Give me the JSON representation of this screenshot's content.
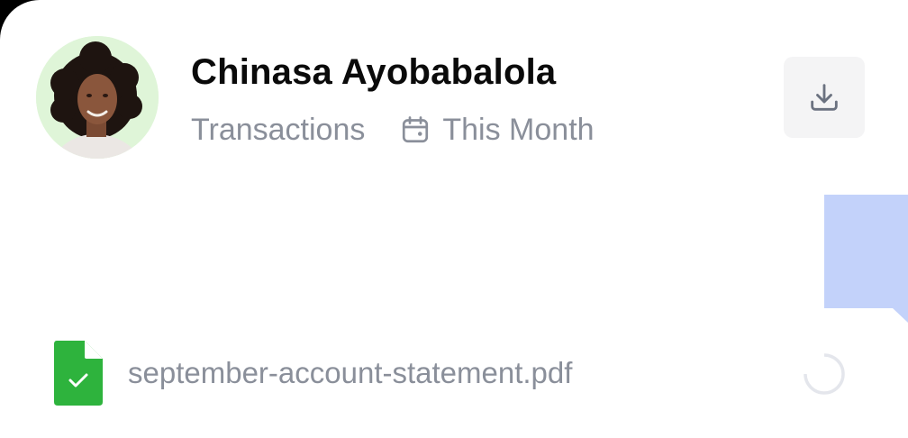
{
  "profile": {
    "name": "Chinasa Ayobabalola",
    "subtitle": "Transactions",
    "period": "This Month"
  },
  "file": {
    "name": "september-account-statement.pdf",
    "status": "uploaded"
  },
  "icons": {
    "calendar": "calendar-icon",
    "download": "download-icon",
    "file": "file-check-icon",
    "spinner": "loading-spinner-icon"
  },
  "colors": {
    "name_text": "#0a0a0a",
    "muted_text": "#8a8f9a",
    "avatar_bg": "#dff5d8",
    "button_bg": "#f4f4f5",
    "file_icon_green": "#2eb33d",
    "decor_blue": "#c3d2fa"
  }
}
